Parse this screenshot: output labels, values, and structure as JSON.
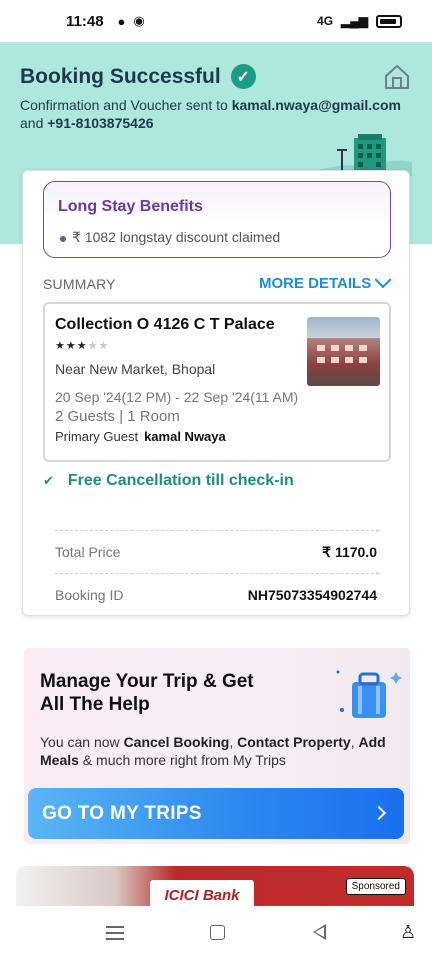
{
  "status_bar": {
    "time": "11:48",
    "network": "4G"
  },
  "header": {
    "title": "Booking Successful",
    "confirm_prefix": "Confirmation and Voucher sent to ",
    "email": "kamal.nwaya@gmail.com",
    "confirm_and": "and ",
    "phone": "+91-8103875426"
  },
  "long_stay": {
    "title": "Long Stay Benefits",
    "text": "₹ 1082 longstay discount claimed"
  },
  "summary": {
    "label": "SUMMARY",
    "more_details": "MORE DETAILS"
  },
  "hotel": {
    "name": "Collection O 4126 C T Palace",
    "rating": 3,
    "max_rating": 5,
    "location": "Near New Market, Bhopal",
    "dates": "20 Sep '24(12 PM) - 22 Sep '24(11 AM)",
    "guests": "2 Guests | 1 Room",
    "primary_label": "Primary Guest",
    "primary_name": "kamal Nwaya"
  },
  "cancellation": {
    "text": "Free Cancellation till check-in"
  },
  "pricing": {
    "total_label": "Total Price",
    "total_value": "₹ 1170.0",
    "booking_label": "Booking ID",
    "booking_value": "NH75073354902744"
  },
  "manage": {
    "title": "Manage Your Trip & Get All The Help",
    "desc_1": "You can now ",
    "desc_b1": "Cancel Booking",
    "desc_2": ", ",
    "desc_b2": "Contact Property",
    "desc_3": ", ",
    "desc_b3": "Add Meals",
    "desc_4": " & much more right from My Trips",
    "button": "GO TO MY TRIPS"
  },
  "ad": {
    "brand": "ICICI Bank",
    "sponsored": "Sponsored"
  },
  "colors": {
    "header_bg": "#aee7de",
    "accent_blue": "#1a8fd6",
    "success_green": "#1e9b86",
    "purple": "#6b3aa0"
  }
}
